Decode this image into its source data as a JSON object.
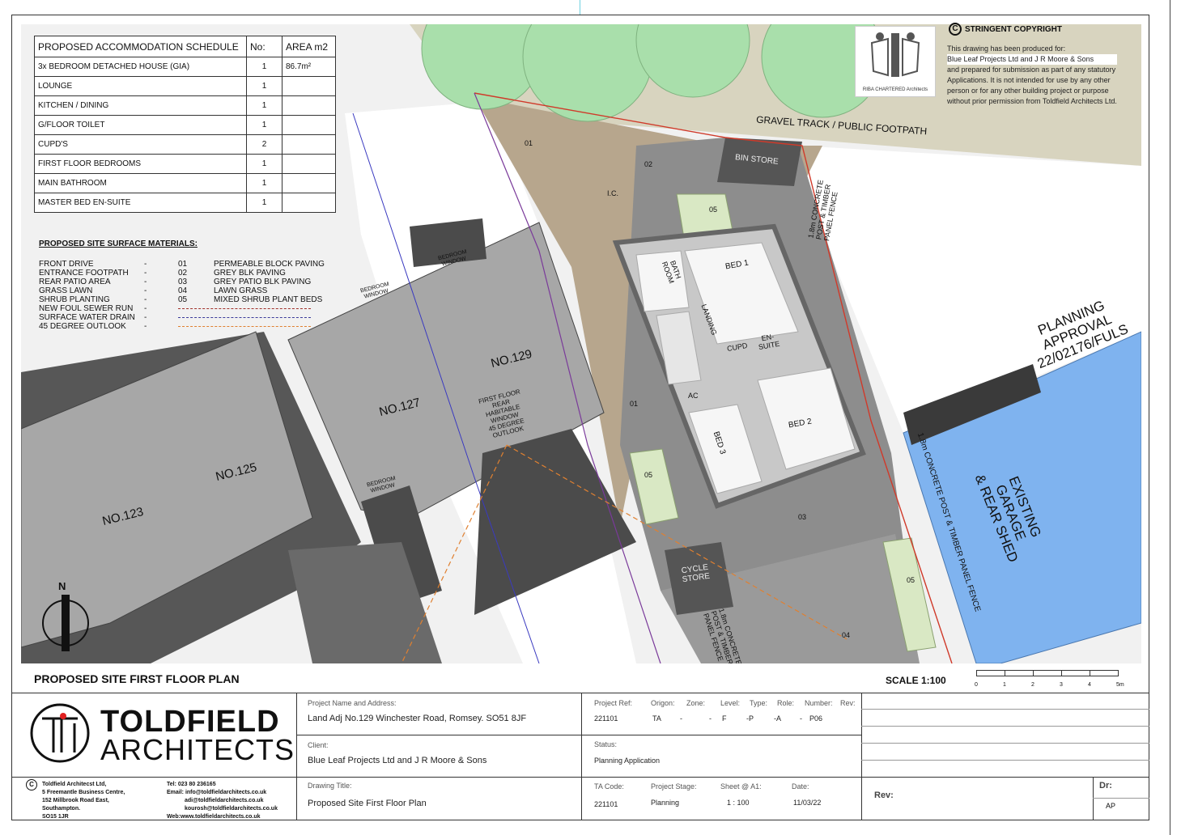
{
  "schedule": {
    "header": [
      "PROPOSED ACCOMMODATION SCHEDULE",
      "No:",
      "AREA m2"
    ],
    "rows": [
      [
        "3x BEDROOM DETACHED HOUSE (GIA)",
        "1",
        "86.7m²"
      ],
      [
        "LOUNGE",
        "1",
        ""
      ],
      [
        "KITCHEN  / DINING",
        "1",
        ""
      ],
      [
        "G/FLOOR TOILET",
        "1",
        ""
      ],
      [
        "CUPD'S",
        "2",
        ""
      ],
      [
        "FIRST FLOOR BEDROOMS",
        "1",
        ""
      ],
      [
        "MAIN BATHROOM",
        "1",
        ""
      ],
      [
        "MASTER BED EN-SUITE",
        "1",
        ""
      ]
    ]
  },
  "materials": {
    "title": "PROPOSED SITE SURFACE MATERIALS:",
    "rows": [
      [
        "FRONT DRIVE",
        "-",
        "01",
        "PERMEABLE BLOCK PAVING"
      ],
      [
        "ENTRANCE FOOTPATH",
        "-",
        "02",
        "GREY BLK PAVING"
      ],
      [
        "REAR PATIO AREA",
        "-",
        "03",
        "GREY PATIO BLK PAVING"
      ],
      [
        "GRASS LAWN",
        "-",
        "04",
        "LAWN GRASS"
      ],
      [
        "SHRUB PLANTING",
        "-",
        "05",
        "MIXED SHRUB PLANT BEDS"
      ],
      [
        "NEW FOUL SEWER RUN",
        "-",
        "",
        ""
      ],
      [
        "SURFACE WATER DRAIN",
        "-",
        "",
        ""
      ],
      [
        "45 DEGREE OUTLOOK",
        "-",
        "",
        ""
      ]
    ],
    "colors": [
      "",
      "",
      "",
      "",
      "",
      "#a0302a",
      "#3a3a9a",
      "#e08030"
    ]
  },
  "copyright": {
    "title": "STRINGENT COPYRIGHT",
    "lines": [
      "This drawing has been produced for:",
      "Blue Leaf Projects Ltd and J R Moore & Sons",
      "and prepared for submission as part of any statutory",
      "Applications. It is not intended for use by any other",
      "person or for any other building project or purpose",
      "without prior permission from Toldfield Architects Ltd."
    ],
    "riba": "RIBA CHARTERED Architects"
  },
  "plan_labels": {
    "gravel": "GRAVEL TRACK / PUBLIC FOOTPATH",
    "bin": "BIN STORE",
    "fence_top": [
      "1.8m CONCRETE",
      "POST & TIMBER",
      "PANEL FENCE"
    ],
    "fence_right": "1.8m CONCRETE POST & TIMBER PANEL FENCE",
    "fence_bottom": [
      "1.8m CONCRETE",
      "POST & TIMBER",
      "PANEL FENCE"
    ],
    "planning": [
      "PLANNING",
      "APPROVAL",
      "22/02176/FULS"
    ],
    "garage": [
      "EXISTING",
      "GARAGE",
      "& REAR SHED"
    ],
    "cycle": [
      "CYCLE",
      "STORE"
    ],
    "houses": [
      "NO.123",
      "NO.125",
      "NO.127",
      "NO.129"
    ],
    "bedroom_window": [
      "BEDROOM",
      "WINDOW"
    ],
    "outlook": [
      "FIRST FLOOR",
      "REAR",
      "HABITABLE",
      "WINDOW",
      "45 DEGREE",
      "OUTLOOK"
    ],
    "rooms": {
      "bath": [
        "BATH",
        "ROOM"
      ],
      "landing": "LANDING",
      "bed1": "BED 1",
      "bed2": "BED 2",
      "bed3": "BED 3",
      "cupd": "CUPD",
      "ensuite": [
        "EN-",
        "SUITE"
      ],
      "ac": "AC",
      "ic": "I.C."
    },
    "zones": [
      "01",
      "02",
      "05",
      "01",
      "05",
      "03",
      "05",
      "04"
    ],
    "north": "N"
  },
  "footer": {
    "plan_title": "PROPOSED SITE FIRST FLOOR PLAN",
    "scale": "SCALE  1:100",
    "scale_ticks": [
      "0",
      "1",
      "2",
      "3",
      "4",
      "5m"
    ]
  },
  "titleblock": {
    "logo_top": "TOLDFIELD",
    "logo_bottom": "ARCHITECTS",
    "company": [
      "Toldfield Architecst Ltd,",
      "5 Freemantle Business Centre,",
      "152 Millbrook Road East,",
      "Southampton.",
      "SO15 1JR"
    ],
    "contact": [
      "Tel: 023 80 236165",
      "Email: info@toldfieldarchitects.co.uk",
      "adi@toldfieldarchitects.co.uk",
      "kourosh@toldfieldarchitects.co.uk",
      "Web:www.toldfieldarchitects.co.uk"
    ],
    "project_label": "Project Name and Address:",
    "project": "Land Adj No.129 Winchester Road, Romsey. SO51 8JF",
    "client_label": "Client:",
    "client": "Blue Leaf Projects Ltd and J R Moore & Sons",
    "drawing_label": "Drawing Title:",
    "drawing": "Proposed Site First Floor Plan",
    "ref_headers": [
      "Project Ref:",
      "Origon:",
      "Zone:",
      "Level:",
      "Type:",
      "Role:",
      "Number:",
      "Rev:"
    ],
    "ref_values": [
      "221101",
      "TA",
      "-",
      "-",
      "F",
      "-P",
      "-A",
      "-",
      "P06"
    ],
    "status_label": "Status:",
    "status": "Planning Application",
    "code_headers": [
      "TA Code:",
      "Project Stage:",
      "Sheet @ A1:",
      "Date:"
    ],
    "code_values": [
      "221101",
      "Planning",
      "1 : 100",
      "11/03/22"
    ],
    "rev_label": "Rev:",
    "dr_label": "Dr:",
    "dr_value": "AP"
  }
}
